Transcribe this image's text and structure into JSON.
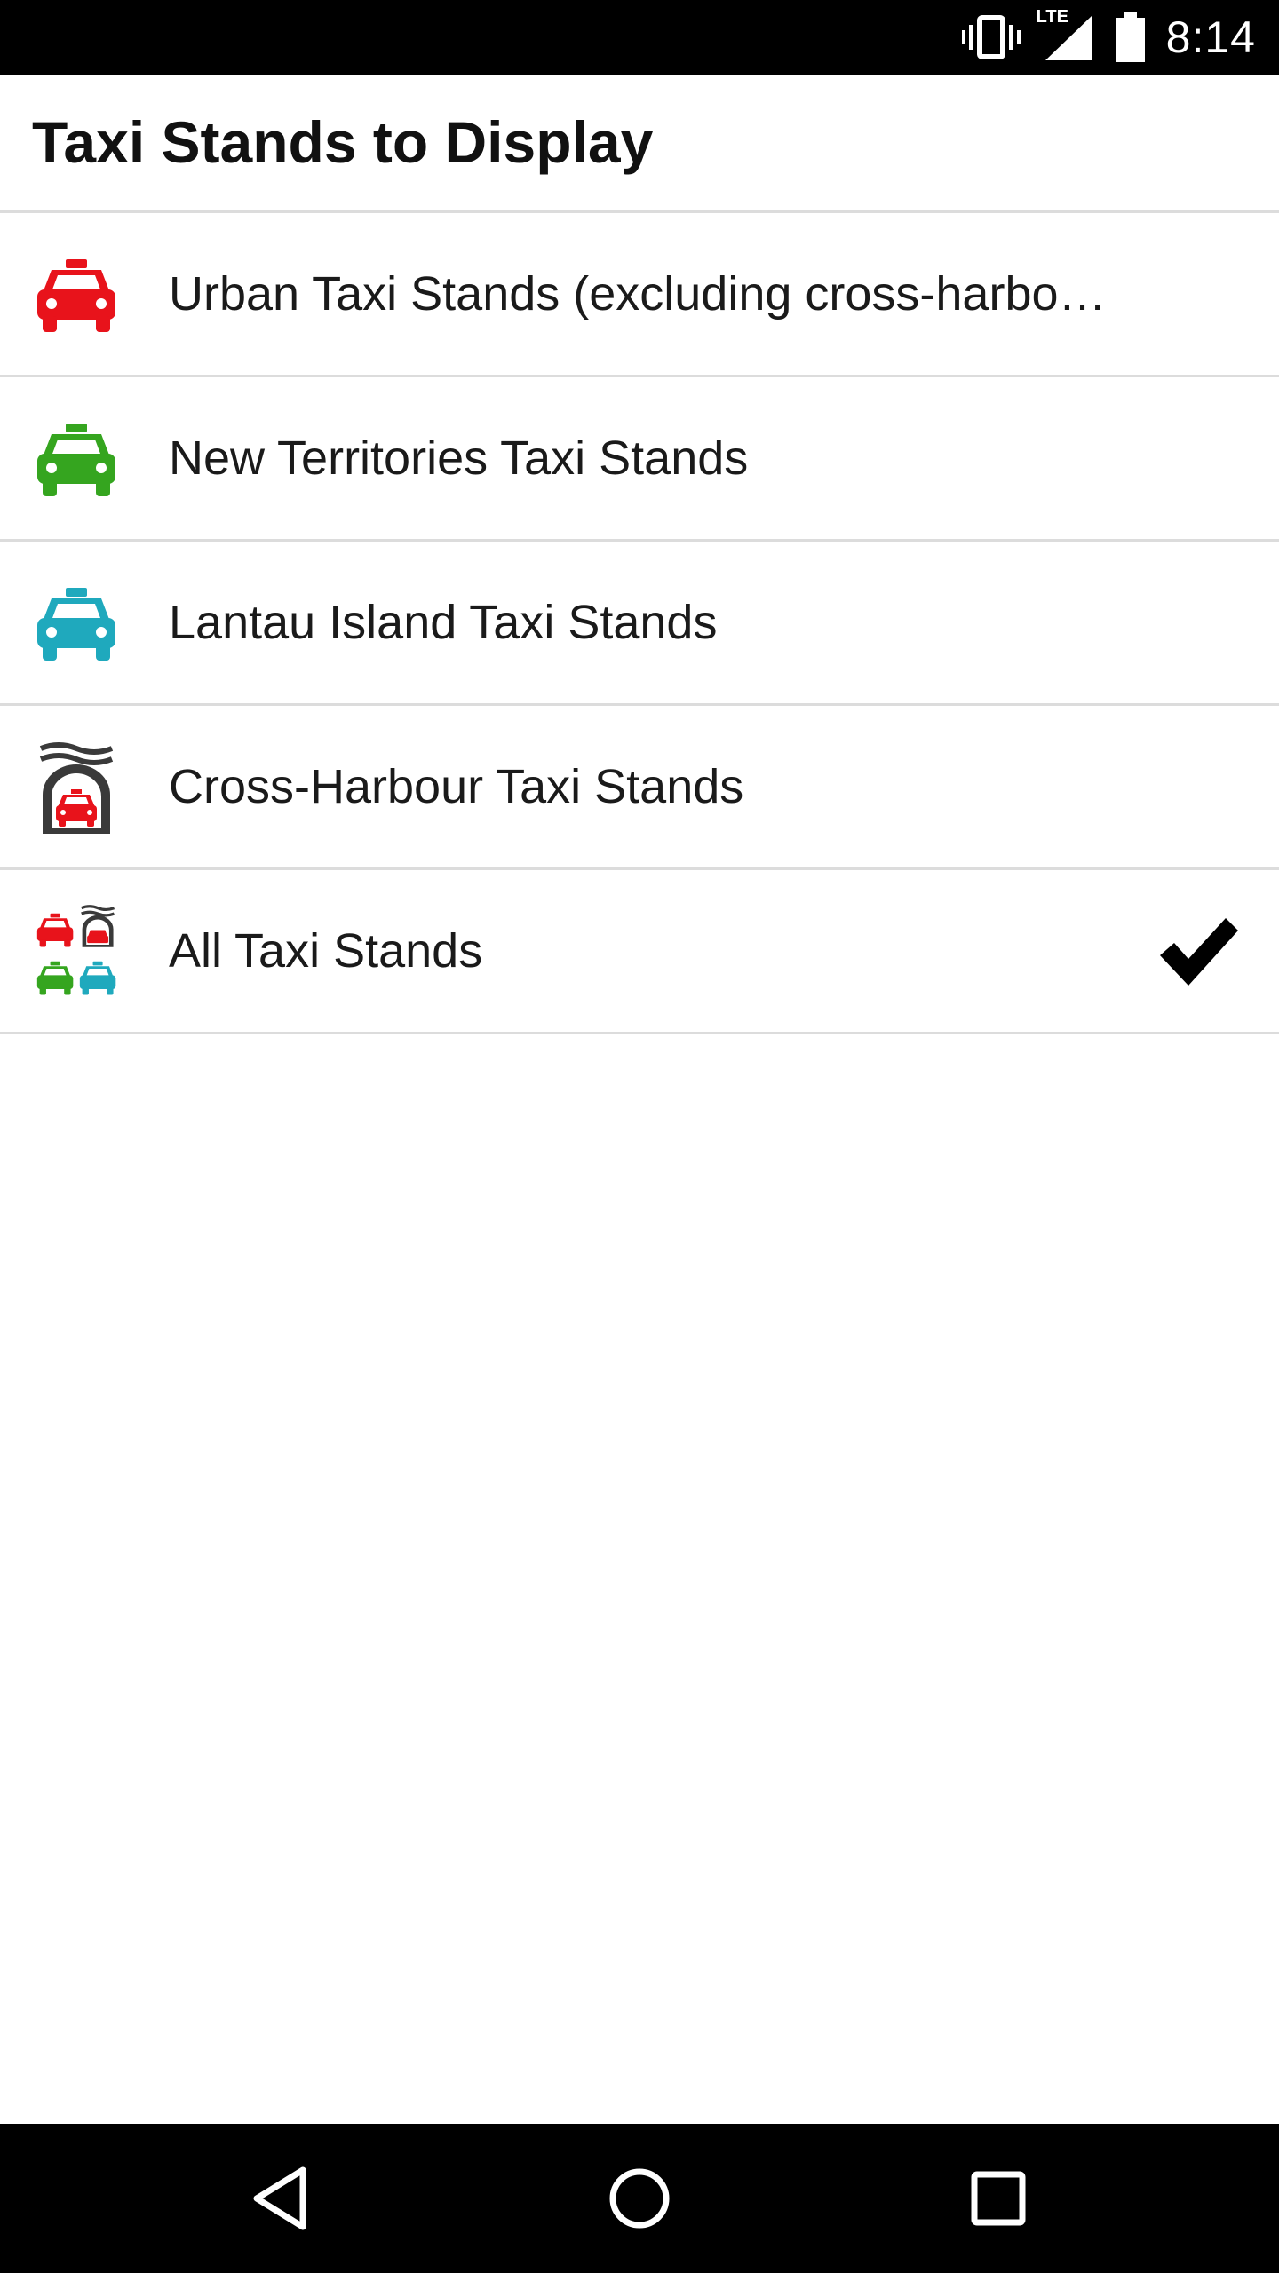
{
  "status_bar": {
    "network_label": "LTE",
    "time": "8:14",
    "icons": [
      "vibrate-icon",
      "signal-icon",
      "battery-icon"
    ]
  },
  "page": {
    "title": "Taxi Stands to Display"
  },
  "items": [
    {
      "label": "Urban Taxi Stands (excluding cross-harbo…",
      "icon": "red-taxi-icon",
      "icon_color": "#e8131b",
      "selected": false
    },
    {
      "label": "New Territories Taxi Stands",
      "icon": "green-taxi-icon",
      "icon_color": "#35a51f",
      "selected": false
    },
    {
      "label": "Lantau Island Taxi Stands",
      "icon": "blue-taxi-icon",
      "icon_color": "#1fa9bd",
      "selected": false
    },
    {
      "label": "Cross-Harbour Taxi Stands",
      "icon": "cross-harbour-tunnel-icon",
      "icon_color": "#e8131b",
      "selected": false
    },
    {
      "label": "All Taxi Stands",
      "icon": "all-taxis-icon",
      "icon_color": "#000000",
      "selected": true
    }
  ],
  "nav": {
    "buttons": [
      "back-icon",
      "home-icon",
      "recents-icon"
    ]
  },
  "colors": {
    "divider": "#dcdcdc",
    "red_taxi": "#e8131b",
    "green_taxi": "#35a51f",
    "blue_taxi": "#1fa9bd",
    "tunnel_gray": "#3a3a3a"
  }
}
